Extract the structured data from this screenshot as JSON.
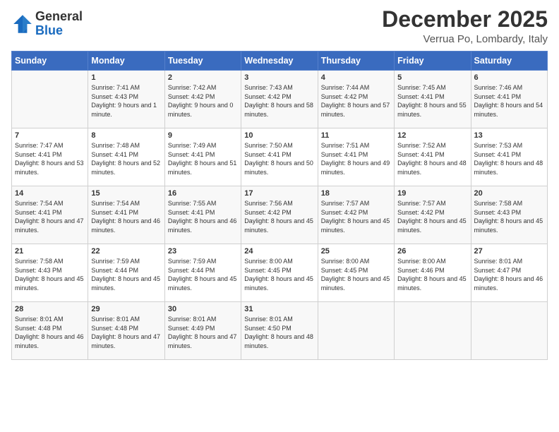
{
  "logo": {
    "general": "General",
    "blue": "Blue"
  },
  "header": {
    "title": "December 2025",
    "location": "Verrua Po, Lombardy, Italy"
  },
  "weekdays": [
    "Sunday",
    "Monday",
    "Tuesday",
    "Wednesday",
    "Thursday",
    "Friday",
    "Saturday"
  ],
  "weeks": [
    [
      {
        "day": "",
        "sunrise": "",
        "sunset": "",
        "daylight": ""
      },
      {
        "day": "1",
        "sunrise": "Sunrise: 7:41 AM",
        "sunset": "Sunset: 4:43 PM",
        "daylight": "Daylight: 9 hours and 1 minute."
      },
      {
        "day": "2",
        "sunrise": "Sunrise: 7:42 AM",
        "sunset": "Sunset: 4:42 PM",
        "daylight": "Daylight: 9 hours and 0 minutes."
      },
      {
        "day": "3",
        "sunrise": "Sunrise: 7:43 AM",
        "sunset": "Sunset: 4:42 PM",
        "daylight": "Daylight: 8 hours and 58 minutes."
      },
      {
        "day": "4",
        "sunrise": "Sunrise: 7:44 AM",
        "sunset": "Sunset: 4:42 PM",
        "daylight": "Daylight: 8 hours and 57 minutes."
      },
      {
        "day": "5",
        "sunrise": "Sunrise: 7:45 AM",
        "sunset": "Sunset: 4:41 PM",
        "daylight": "Daylight: 8 hours and 55 minutes."
      },
      {
        "day": "6",
        "sunrise": "Sunrise: 7:46 AM",
        "sunset": "Sunset: 4:41 PM",
        "daylight": "Daylight: 8 hours and 54 minutes."
      }
    ],
    [
      {
        "day": "7",
        "sunrise": "Sunrise: 7:47 AM",
        "sunset": "Sunset: 4:41 PM",
        "daylight": "Daylight: 8 hours and 53 minutes."
      },
      {
        "day": "8",
        "sunrise": "Sunrise: 7:48 AM",
        "sunset": "Sunset: 4:41 PM",
        "daylight": "Daylight: 8 hours and 52 minutes."
      },
      {
        "day": "9",
        "sunrise": "Sunrise: 7:49 AM",
        "sunset": "Sunset: 4:41 PM",
        "daylight": "Daylight: 8 hours and 51 minutes."
      },
      {
        "day": "10",
        "sunrise": "Sunrise: 7:50 AM",
        "sunset": "Sunset: 4:41 PM",
        "daylight": "Daylight: 8 hours and 50 minutes."
      },
      {
        "day": "11",
        "sunrise": "Sunrise: 7:51 AM",
        "sunset": "Sunset: 4:41 PM",
        "daylight": "Daylight: 8 hours and 49 minutes."
      },
      {
        "day": "12",
        "sunrise": "Sunrise: 7:52 AM",
        "sunset": "Sunset: 4:41 PM",
        "daylight": "Daylight: 8 hours and 48 minutes."
      },
      {
        "day": "13",
        "sunrise": "Sunrise: 7:53 AM",
        "sunset": "Sunset: 4:41 PM",
        "daylight": "Daylight: 8 hours and 48 minutes."
      }
    ],
    [
      {
        "day": "14",
        "sunrise": "Sunrise: 7:54 AM",
        "sunset": "Sunset: 4:41 PM",
        "daylight": "Daylight: 8 hours and 47 minutes."
      },
      {
        "day": "15",
        "sunrise": "Sunrise: 7:54 AM",
        "sunset": "Sunset: 4:41 PM",
        "daylight": "Daylight: 8 hours and 46 minutes."
      },
      {
        "day": "16",
        "sunrise": "Sunrise: 7:55 AM",
        "sunset": "Sunset: 4:41 PM",
        "daylight": "Daylight: 8 hours and 46 minutes."
      },
      {
        "day": "17",
        "sunrise": "Sunrise: 7:56 AM",
        "sunset": "Sunset: 4:42 PM",
        "daylight": "Daylight: 8 hours and 45 minutes."
      },
      {
        "day": "18",
        "sunrise": "Sunrise: 7:57 AM",
        "sunset": "Sunset: 4:42 PM",
        "daylight": "Daylight: 8 hours and 45 minutes."
      },
      {
        "day": "19",
        "sunrise": "Sunrise: 7:57 AM",
        "sunset": "Sunset: 4:42 PM",
        "daylight": "Daylight: 8 hours and 45 minutes."
      },
      {
        "day": "20",
        "sunrise": "Sunrise: 7:58 AM",
        "sunset": "Sunset: 4:43 PM",
        "daylight": "Daylight: 8 hours and 45 minutes."
      }
    ],
    [
      {
        "day": "21",
        "sunrise": "Sunrise: 7:58 AM",
        "sunset": "Sunset: 4:43 PM",
        "daylight": "Daylight: 8 hours and 45 minutes."
      },
      {
        "day": "22",
        "sunrise": "Sunrise: 7:59 AM",
        "sunset": "Sunset: 4:44 PM",
        "daylight": "Daylight: 8 hours and 45 minutes."
      },
      {
        "day": "23",
        "sunrise": "Sunrise: 7:59 AM",
        "sunset": "Sunset: 4:44 PM",
        "daylight": "Daylight: 8 hours and 45 minutes."
      },
      {
        "day": "24",
        "sunrise": "Sunrise: 8:00 AM",
        "sunset": "Sunset: 4:45 PM",
        "daylight": "Daylight: 8 hours and 45 minutes."
      },
      {
        "day": "25",
        "sunrise": "Sunrise: 8:00 AM",
        "sunset": "Sunset: 4:45 PM",
        "daylight": "Daylight: 8 hours and 45 minutes."
      },
      {
        "day": "26",
        "sunrise": "Sunrise: 8:00 AM",
        "sunset": "Sunset: 4:46 PM",
        "daylight": "Daylight: 8 hours and 45 minutes."
      },
      {
        "day": "27",
        "sunrise": "Sunrise: 8:01 AM",
        "sunset": "Sunset: 4:47 PM",
        "daylight": "Daylight: 8 hours and 46 minutes."
      }
    ],
    [
      {
        "day": "28",
        "sunrise": "Sunrise: 8:01 AM",
        "sunset": "Sunset: 4:48 PM",
        "daylight": "Daylight: 8 hours and 46 minutes."
      },
      {
        "day": "29",
        "sunrise": "Sunrise: 8:01 AM",
        "sunset": "Sunset: 4:48 PM",
        "daylight": "Daylight: 8 hours and 47 minutes."
      },
      {
        "day": "30",
        "sunrise": "Sunrise: 8:01 AM",
        "sunset": "Sunset: 4:49 PM",
        "daylight": "Daylight: 8 hours and 47 minutes."
      },
      {
        "day": "31",
        "sunrise": "Sunrise: 8:01 AM",
        "sunset": "Sunset: 4:50 PM",
        "daylight": "Daylight: 8 hours and 48 minutes."
      },
      {
        "day": "",
        "sunrise": "",
        "sunset": "",
        "daylight": ""
      },
      {
        "day": "",
        "sunrise": "",
        "sunset": "",
        "daylight": ""
      },
      {
        "day": "",
        "sunrise": "",
        "sunset": "",
        "daylight": ""
      }
    ]
  ]
}
